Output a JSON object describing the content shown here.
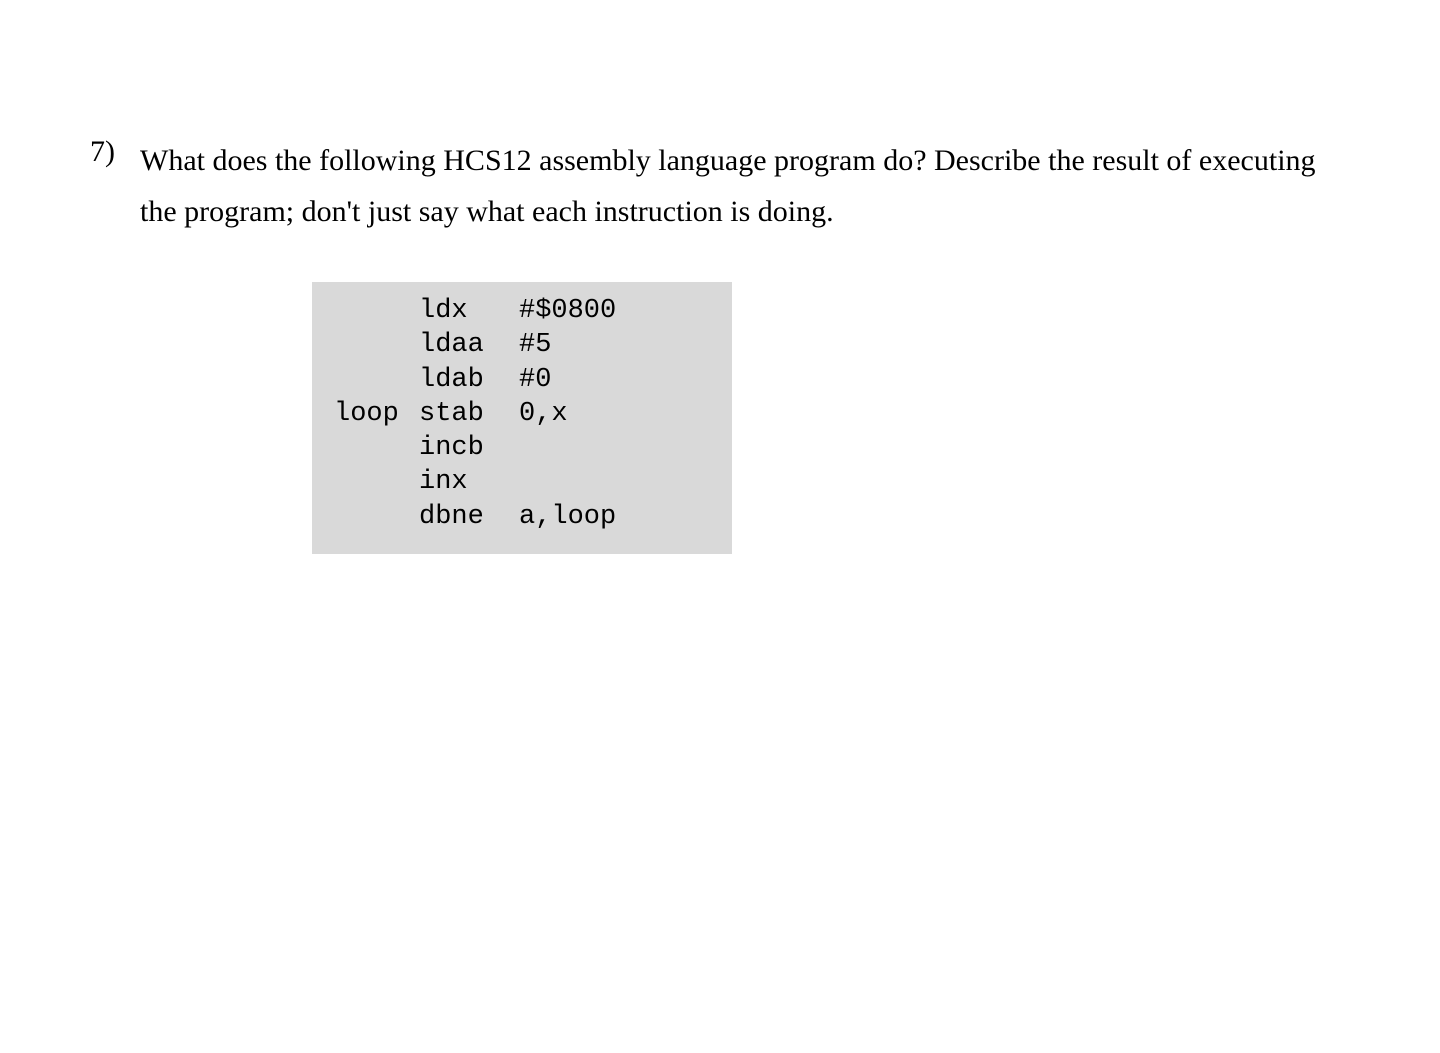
{
  "question": {
    "number": "7)",
    "text": "What does the following HCS12 assembly language program do? Describe the result of executing the program; don't just say what each instruction is doing."
  },
  "code": {
    "lines": [
      {
        "label": "",
        "mnemonic": "ldx",
        "operand": "#$0800"
      },
      {
        "label": "",
        "mnemonic": "ldaa",
        "operand": "#5"
      },
      {
        "label": "",
        "mnemonic": "ldab",
        "operand": "#0"
      },
      {
        "label": "loop",
        "mnemonic": "stab",
        "operand": "0,x"
      },
      {
        "label": "",
        "mnemonic": "incb",
        "operand": ""
      },
      {
        "label": "",
        "mnemonic": "inx",
        "operand": ""
      },
      {
        "label": "",
        "mnemonic": "dbne",
        "operand": "a,loop"
      }
    ]
  }
}
